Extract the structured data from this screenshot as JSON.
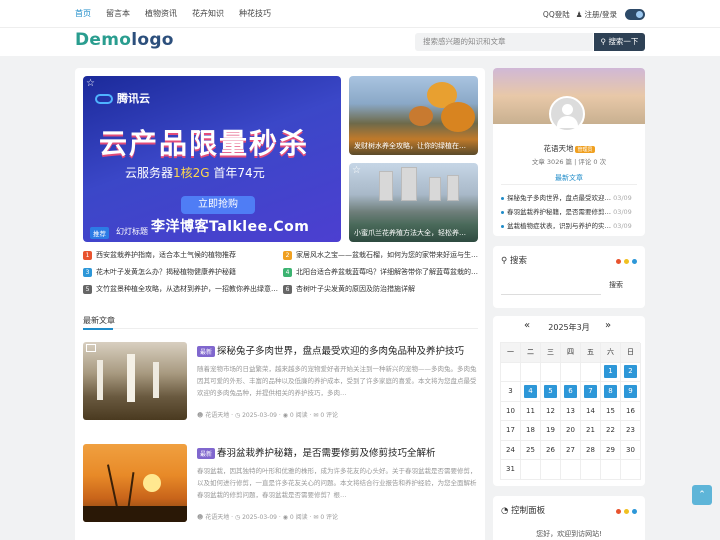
{
  "nav": {
    "items": [
      {
        "label": "首页",
        "active": true
      },
      {
        "label": "留言本"
      },
      {
        "label": "植物资讯"
      },
      {
        "label": "花卉知识"
      },
      {
        "label": "种花技巧"
      }
    ],
    "qq_login": "QQ登陆",
    "register_login": "注册/登录"
  },
  "header": {
    "logo_a": "Demo",
    "logo_b": "logo",
    "search_placeholder": "搜索感兴趣的知识和文章",
    "search_button": "搜索一下"
  },
  "slider": {
    "brand": "腾讯云",
    "headline": "云产品限量秒杀",
    "sub_a": "云服务器",
    "sub_b": "1核2G",
    "sub_c": "首年74元",
    "button": "立即抢购",
    "watermark": "李洋博客Talklee.Com",
    "badge": "推荐",
    "title": "幻灯标题"
  },
  "side_images": [
    {
      "caption": "发财树水养全攻略，让你的绿植在…"
    },
    {
      "caption": "小蜜爪兰花养殖方法大全，轻松养…"
    }
  ],
  "hot_list": [
    {
      "num": "1",
      "text": "西安盆栽养护指南，适合本土气候的植物推荐",
      "color": "#e8532e"
    },
    {
      "num": "2",
      "text": "家居风水之宝——盆栽石榴，如何为您的家带来好运与生…",
      "color": "#f0a020"
    },
    {
      "num": "3",
      "text": "花木叶子发黄怎么办？揭秘植物健康养护秘籍",
      "color": "#2d97d8"
    },
    {
      "num": "4",
      "text": "北阳台适合养盆栽蓝莓吗？详细解答带你了解蓝莓盆栽的…",
      "color": "#3cb371"
    },
    {
      "num": "5",
      "text": "文竹盆景种植全攻略，从选材到养护，一招教你养出绿意…",
      "color": "#666666"
    },
    {
      "num": "6",
      "text": "杏树叶子尖发黄的原因及防治措施详解",
      "color": "#666666"
    }
  ],
  "section_title": "最新文章",
  "posts": [
    {
      "tag": "最新",
      "title": "探秘兔子多肉世界，盘点最受欢迎的多肉兔品种及养护技巧",
      "excerpt": "随着宠物市场的日益繁荣，越来越多的宠物爱好者开始关注到一种新兴的宠物——多肉兔。多肉兔因其可爱的外形、丰富的品种以及低廉的养护成本，受到了许多家庭的喜爱。本文将为您盘点最受欢迎的多肉兔品种，并提供相关的养护技巧，多肉…",
      "author": "花语天地",
      "date": "2025-03-09",
      "reads": "0 阅读",
      "comments": "0 评论"
    },
    {
      "tag": "最新",
      "title": "春羽盆栽养护秘籍，是否需要修剪及修剪技巧全解析",
      "excerpt": "春羽盆栽，因其独特的叶形和优雅的株形，成为许多花友的心头好。关于春羽盆栽是否需要修剪，以及如何进行修剪，一直是许多花友关心的问题。本文将结合行业报告和养护经验，为您全面解析春羽盆栽的修剪问题，春羽盆栽是否需要修剪？根…",
      "author": "花语天地",
      "date": "2025-03-09",
      "reads": "0 阅读",
      "comments": "0 评论"
    }
  ],
  "profile": {
    "name": "花语天地",
    "badge": "管理员",
    "stats": "文章 3026 篇 | 评论 0 次",
    "latest_label": "最新文章",
    "latest": [
      {
        "title": "探秘兔子多肉世界，盘点最受欢迎…",
        "date": "03/09"
      },
      {
        "title": "春羽盆栽养护秘籍，是否需要修剪…",
        "date": "03/09"
      },
      {
        "title": "盆栽植物症状表，识别与养护的实…",
        "date": "03/09"
      }
    ]
  },
  "search_widget": {
    "title": "搜索",
    "button": "搜索"
  },
  "calendar": {
    "month": "2025年3月",
    "weekdays": [
      "一",
      "二",
      "三",
      "四",
      "五",
      "六",
      "日"
    ],
    "highlight_days": [
      1,
      2,
      4,
      5,
      6,
      7,
      8,
      9
    ]
  },
  "panel": {
    "title": "控制面板",
    "text": "您好，欢迎到访网站!"
  },
  "widget_dot_colors": [
    "#e8532e",
    "#f0c020",
    "#2d97d8"
  ]
}
